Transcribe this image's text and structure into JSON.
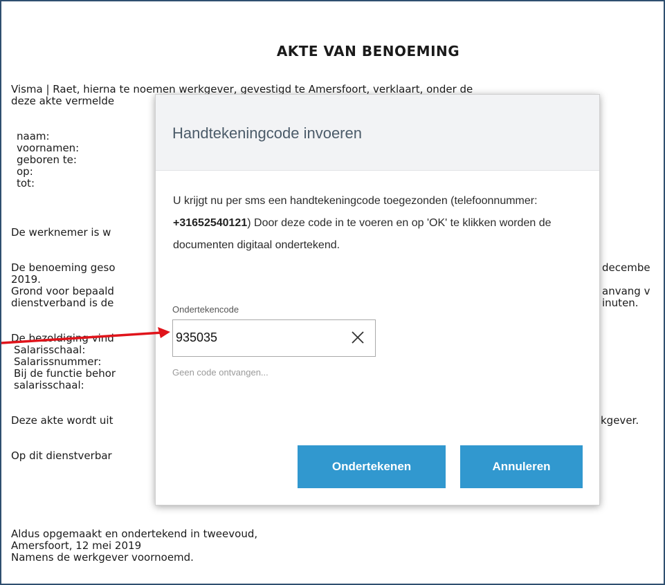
{
  "document": {
    "title": "AKTE VAN BENOEMING",
    "lines": [
      "Visma | Raet, hierna te noemen werkgever, gevestigd te Amersfoort, verklaart, onder de",
      "deze akte vermelde",
      "naam:",
      "voornamen:",
      "geboren te:",
      "op:",
      "tot:",
      "De werknemer is w",
      "De benoeming geso",
      "decembe",
      "2019.",
      "Grond voor bepaald",
      "anvang v",
      "dienstverband is de",
      "inuten.",
      "De bezoldiging vind",
      "Salarisschaal:",
      "Salarissnummer:",
      "Bij de functie behor",
      "salarisschaal:",
      "Deze akte wordt uit",
      "kgever.",
      "Op dit dienstverbar",
      "Aldus opgemaakt en ondertekend in tweevoud,",
      "Amersfoort, 12 mei 2019",
      "Namens de werkgever voornoemd."
    ]
  },
  "modal": {
    "title": "Handtekeningcode invoeren",
    "body_part1": "U krijgt nu per sms een handtekeningcode toegezonden (telefoonnummer: ",
    "phone": "+31652540121",
    "body_part2": ") Door deze code in te voeren en op 'OK' te klikken worden de documenten digitaal ondertekend.",
    "field_label": "Ondertekencode",
    "field_value": "935035",
    "clear_icon": "close-icon",
    "no_code_link": "Geen code ontvangen...",
    "sign_button": "Ondertekenen",
    "cancel_button": "Annuleren"
  },
  "colors": {
    "button": "#3198cf",
    "header_bg": "#f2f3f5",
    "title_text": "#4b5b69",
    "arrow": "#e0141b",
    "frame_border": "#2f4f6f"
  }
}
